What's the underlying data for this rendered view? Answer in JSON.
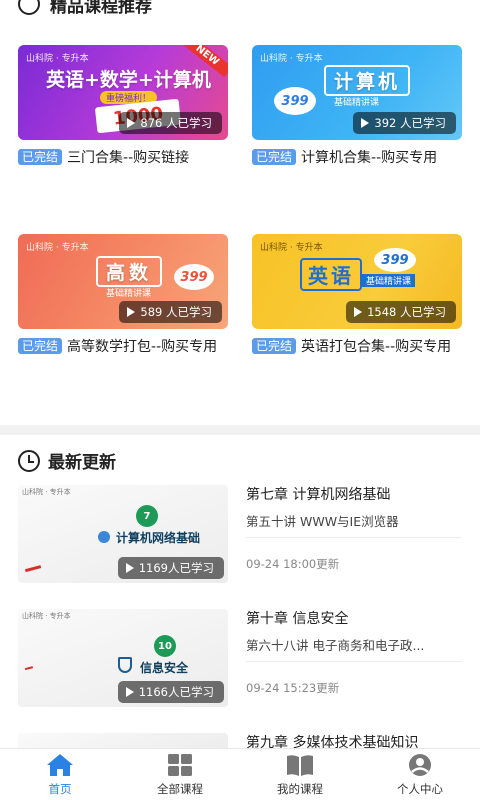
{
  "top_section": {
    "title": "精品课程推荐"
  },
  "courses": [
    {
      "status": "已完结",
      "title": "三门合集--购买链接",
      "thumb_text": "英语+数学+计算机",
      "thumb_sub": "重磅福利！",
      "thumb_price": "1000",
      "thumb_tag": "NEW",
      "learners": "876 人已学习"
    },
    {
      "status": "已完结",
      "title": "计算机合集--购买专用",
      "thumb_text": "计算机",
      "thumb_sub": "基础精讲课",
      "thumb_price": "399",
      "learners": "392 人已学习"
    },
    {
      "status": "已完结",
      "title": "高等数学打包--购买专用",
      "thumb_text": "高数",
      "thumb_sub": "基础精讲课",
      "thumb_price": "399",
      "learners": "589 人已学习"
    },
    {
      "status": "已完结",
      "title": "英语打包合集--购买专用",
      "thumb_text": "英语",
      "thumb_sub": "基础精讲课",
      "thumb_price": "399",
      "learners": "1548 人已学习"
    }
  ],
  "thumb_brand": "山科院 · 专升本",
  "latest_section": {
    "title": "最新更新"
  },
  "updates": [
    {
      "thumb_number": "7",
      "thumb_name": "计算机网络基础",
      "learners": "1169人已学习",
      "chapter": "第七章 计算机网络基础",
      "lecture": "第五十讲 WWW与IE浏览器",
      "updated": "09-24 18:00更新"
    },
    {
      "thumb_number": "10",
      "thumb_name": "信息安全",
      "learners": "1166人已学习",
      "chapter": "第十章 信息安全",
      "lecture": "第六十八讲 电子商务和电子政...",
      "updated": "09-24 15:23更新"
    },
    {
      "chapter": "第九章 多媒体技术基础知识"
    }
  ],
  "tabs": [
    {
      "label": "首页",
      "icon": "home-icon",
      "active": true
    },
    {
      "label": "全部课程",
      "icon": "grid-icon",
      "active": false
    },
    {
      "label": "我的课程",
      "icon": "book-icon",
      "active": false
    },
    {
      "label": "个人中心",
      "icon": "user-icon",
      "active": false
    }
  ],
  "colors": {
    "accent": "#2a82e4",
    "badge": "#5b9be9"
  }
}
